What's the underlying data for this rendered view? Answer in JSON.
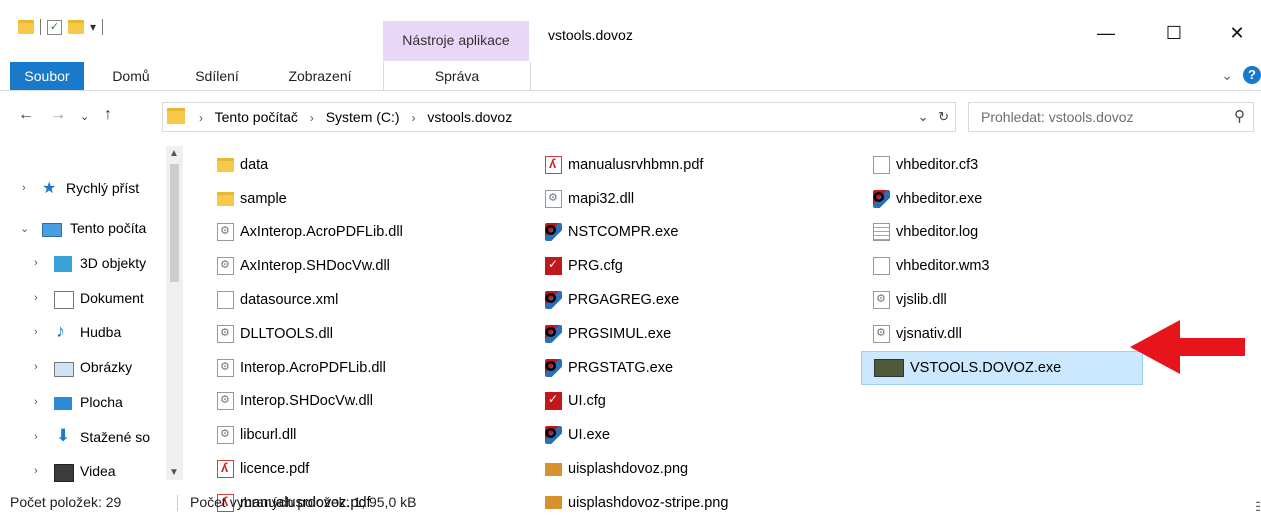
{
  "window": {
    "title": "vstools.dovoz",
    "context_tab": "Nástroje aplikace",
    "controls": {
      "minimize": "—",
      "maximize": "☐",
      "close": "✕"
    }
  },
  "ribbon": {
    "tabs": [
      "Soubor",
      "Domů",
      "Sdílení",
      "Zobrazení",
      "Správa"
    ],
    "collapse": "⌄",
    "help": "?"
  },
  "address": {
    "crumbs": [
      "Tento počítač",
      "System (C:)",
      "vstools.dovoz"
    ],
    "history_icon": "⌄",
    "refresh_icon": "↻"
  },
  "search": {
    "placeholder": "Prohledat: vstools.dovoz"
  },
  "nav": {
    "items": [
      {
        "label": "Rychlý příst",
        "icon": "star-icon"
      },
      {
        "label": "Tento počíta",
        "icon": "pc-icon"
      },
      {
        "label": "3D objekty",
        "icon": "cube-icon"
      },
      {
        "label": "Dokument",
        "icon": "document-icon"
      },
      {
        "label": "Hudba",
        "icon": "music-icon"
      },
      {
        "label": "Obrázky",
        "icon": "pictures-icon"
      },
      {
        "label": "Plocha",
        "icon": "desktop-icon"
      },
      {
        "label": "Stažené so",
        "icon": "download-icon"
      },
      {
        "label": "Videa",
        "icon": "video-icon"
      }
    ]
  },
  "files": {
    "col1": [
      {
        "name": "data",
        "type": "folder"
      },
      {
        "name": "sample",
        "type": "folder"
      },
      {
        "name": "AxInterop.AcroPDFLib.dll",
        "type": "dll"
      },
      {
        "name": "AxInterop.SHDocVw.dll",
        "type": "dll"
      },
      {
        "name": "datasource.xml",
        "type": "doc"
      },
      {
        "name": "DLLTOOLS.dll",
        "type": "dll"
      },
      {
        "name": "Interop.AcroPDFLib.dll",
        "type": "dll"
      },
      {
        "name": "Interop.SHDocVw.dll",
        "type": "dll"
      },
      {
        "name": "libcurl.dll",
        "type": "dll"
      },
      {
        "name": "licence.pdf",
        "type": "pdf"
      },
      {
        "name": "manualusrdovoz.pdf",
        "type": "pdf"
      }
    ],
    "col2": [
      {
        "name": "manualusrvhbmn.pdf",
        "type": "pdf"
      },
      {
        "name": "mapi32.dll",
        "type": "dll"
      },
      {
        "name": "NSTCOMPR.exe",
        "type": "exe"
      },
      {
        "name": "PRG.cfg",
        "type": "cfg"
      },
      {
        "name": "PRGAGREG.exe",
        "type": "exe"
      },
      {
        "name": "PRGSIMUL.exe",
        "type": "exe"
      },
      {
        "name": "PRGSTATG.exe",
        "type": "exe"
      },
      {
        "name": "UI.cfg",
        "type": "cfg"
      },
      {
        "name": "UI.exe",
        "type": "exe"
      },
      {
        "name": "uisplashdovoz.png",
        "type": "png"
      },
      {
        "name": "uisplashdovoz-stripe.png",
        "type": "png"
      }
    ],
    "col3": [
      {
        "name": "vhbeditor.cf3",
        "type": "doc"
      },
      {
        "name": "vhbeditor.exe",
        "type": "exe"
      },
      {
        "name": "vhbeditor.log",
        "type": "log"
      },
      {
        "name": "vhbeditor.wm3",
        "type": "doc"
      },
      {
        "name": "vjslib.dll",
        "type": "dll"
      },
      {
        "name": "vjsnativ.dll",
        "type": "dll"
      },
      {
        "name": "VSTOOLS.DOVOZ.exe",
        "type": "bigexe",
        "selected": true
      }
    ]
  },
  "status": {
    "count": "Počet položek: 29",
    "selected": "Počet vybraných položek: 1; 95,0 kB"
  },
  "colors": {
    "accent": "#1979ca",
    "selection": "#cce8ff",
    "arrow": "#e8141b",
    "context_tab": "#e9d7f7"
  }
}
